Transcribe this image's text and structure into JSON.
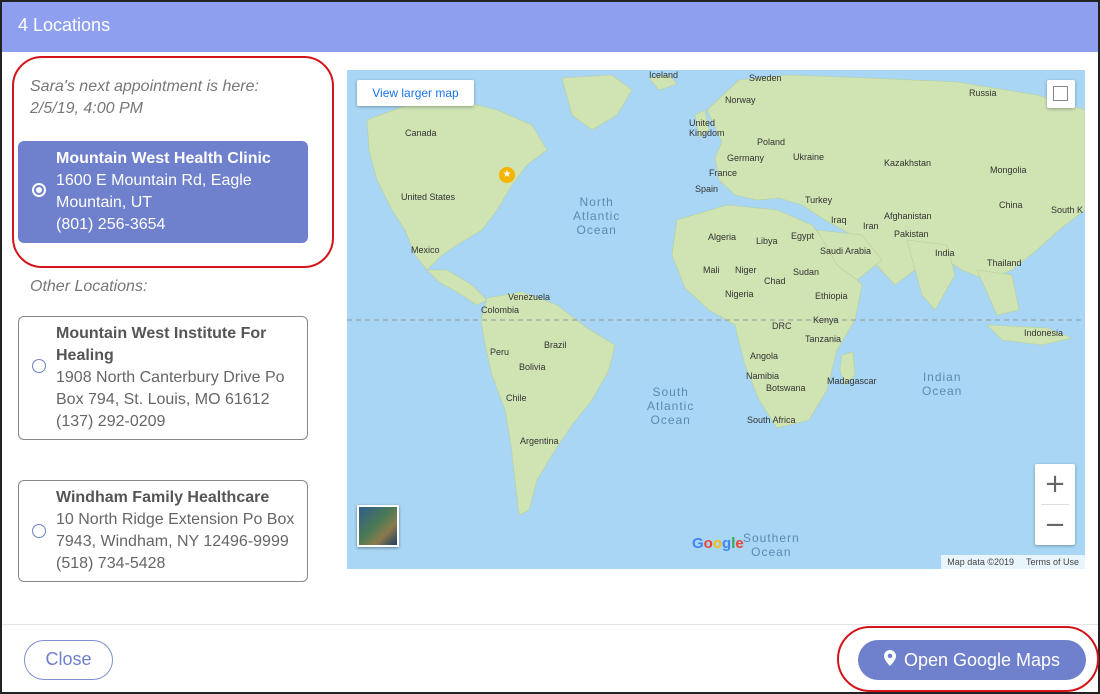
{
  "header": {
    "title": "4 Locations"
  },
  "sidebar": {
    "appointment_note": [
      "Sara's next appointment is here:",
      "2/5/19, 4:00 PM"
    ],
    "selected_location": {
      "name": "Mountain West Health Clinic",
      "address": "1600 E Mountain Rd, Eagle Mountain, UT",
      "phone": "(801) 256-3654"
    },
    "other_label": "Other Locations:",
    "other_locations": [
      {
        "name": "Mountain West Institute For Healing",
        "address": "1908 North Canterbury Drive Po Box 794, St. Louis, MO 61612",
        "phone": "(137) 292-0209"
      },
      {
        "name": "Windham Family Healthcare",
        "address": "10 North Ridge Extension Po Box 7943, Windham, NY 12496-9999",
        "phone": "(518) 734-5428"
      }
    ]
  },
  "map": {
    "view_larger_label": "View larger map",
    "zoom_in": "+",
    "zoom_out": "−",
    "google_logo": "Google",
    "attribution": {
      "map_data": "Map data ©2019",
      "terms": "Terms of Use"
    },
    "oceans": {
      "north_atlantic": [
        "North",
        "Atlantic",
        "Ocean"
      ],
      "south_atlantic": [
        "South",
        "Atlantic",
        "Ocean"
      ],
      "indian": [
        "Indian",
        "Ocean"
      ],
      "southern": [
        "Southern",
        "Ocean"
      ]
    },
    "labels": {
      "iceland": "Iceland",
      "sweden": "Sweden",
      "norway": "Norway",
      "russia": "Russia",
      "canada": "Canada",
      "united_kingdom": "United Kingdom",
      "poland": "Poland",
      "germany": "Germany",
      "ukraine": "Ukraine",
      "france": "France",
      "kazakhstan": "Kazakhstan",
      "mongolia": "Mongolia",
      "spain": "Spain",
      "turkey": "Turkey",
      "united_states": "United States",
      "china": "China",
      "south_korea": "South K",
      "iraq": "Iraq",
      "iran": "Iran",
      "afghanistan": "Afghanistan",
      "pakistan": "Pakistan",
      "algeria": "Algeria",
      "libya": "Libya",
      "egypt": "Egypt",
      "saudi_arabia": "Saudi Arabia",
      "mexico": "Mexico",
      "india": "India",
      "thailand": "Thailand",
      "mali": "Mali",
      "niger": "Niger",
      "chad": "Chad",
      "sudan": "Sudan",
      "nigeria": "Nigeria",
      "ethiopia": "Ethiopia",
      "venezuela": "Venezuela",
      "colombia": "Colombia",
      "kenya": "Kenya",
      "drc": "DRC",
      "tanzania": "Tanzania",
      "indonesia": "Indonesia",
      "brazil": "Brazil",
      "peru": "Peru",
      "angola": "Angola",
      "bolivia": "Bolivia",
      "namibia": "Namibia",
      "madagascar": "Madagascar",
      "botswana": "Botswana",
      "chile": "Chile",
      "south_africa": "South Africa",
      "argentina": "Argentina"
    },
    "colors": {
      "water": "#a8d6f4",
      "land": "#cfe3b3",
      "marker": "#f4b400"
    }
  },
  "footer": {
    "close_label": "Close",
    "open_maps_label": "Open Google Maps"
  },
  "colors": {
    "accent": "#6f80cc",
    "header": "#8e9ff0",
    "annotation": "#d4141b"
  }
}
